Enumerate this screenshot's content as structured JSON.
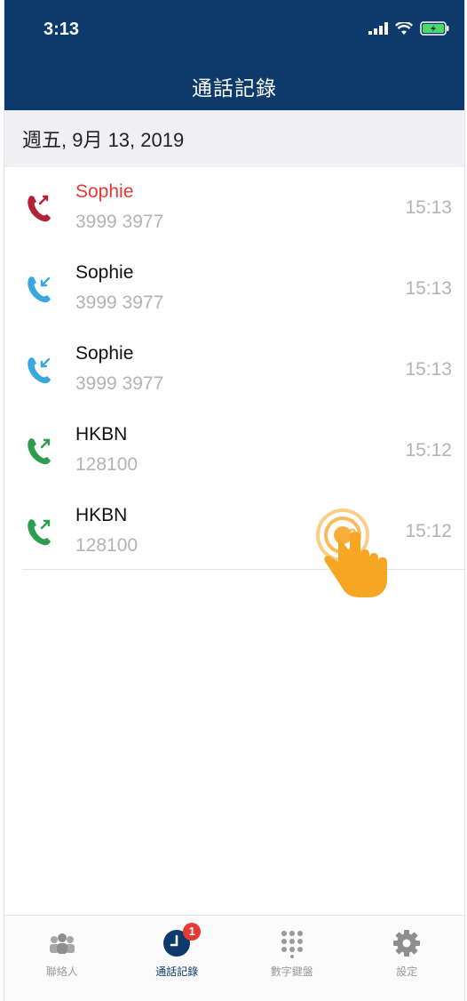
{
  "status_bar": {
    "time": "3:13"
  },
  "header": {
    "title": "通話記錄"
  },
  "section": {
    "date": "週五, 9月 13, 2019"
  },
  "calls": [
    {
      "name": "Sophie",
      "number": "3999 3977",
      "time": "15:13",
      "type": "missed"
    },
    {
      "name": "Sophie",
      "number": "3999 3977",
      "time": "15:13",
      "type": "incoming"
    },
    {
      "name": "Sophie",
      "number": "3999 3977",
      "time": "15:13",
      "type": "incoming"
    },
    {
      "name": "HKBN",
      "number": "128100",
      "time": "15:12",
      "type": "outgoing"
    },
    {
      "name": "HKBN",
      "number": "128100",
      "time": "15:12",
      "type": "outgoing"
    }
  ],
  "tabs": [
    {
      "label": "聯絡人",
      "icon": "contacts-icon"
    },
    {
      "label": "通話記錄",
      "icon": "call-history-icon",
      "badge": "1",
      "active": true
    },
    {
      "label": "數字鍵盤",
      "icon": "keypad-icon"
    },
    {
      "label": "設定",
      "icon": "settings-icon"
    }
  ],
  "colors": {
    "header": "#0b3a6b",
    "missed": "#b22234",
    "incoming": "#3aa7e0",
    "outgoing": "#2e9e4e",
    "badge": "#e53935",
    "tap_hint": "#f5a623"
  }
}
